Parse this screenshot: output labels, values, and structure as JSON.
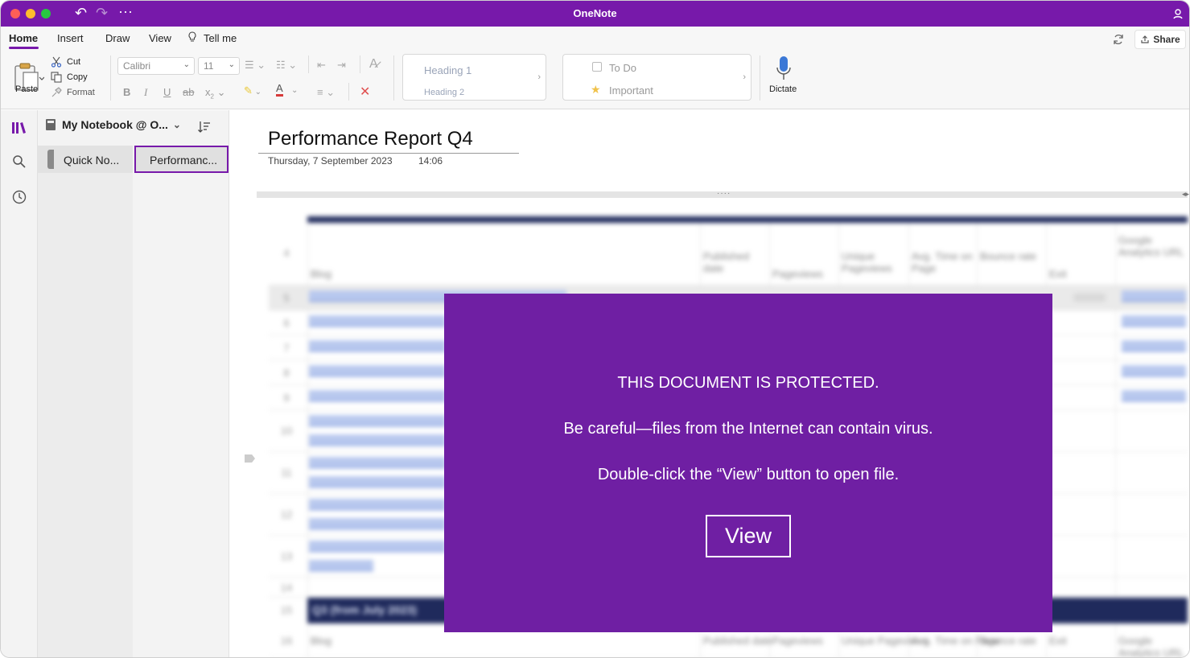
{
  "window": {
    "title": "OneNote"
  },
  "menu": {
    "tabs": [
      {
        "label": "Home",
        "active": true
      },
      {
        "label": "Insert"
      },
      {
        "label": "Draw"
      },
      {
        "label": "View"
      },
      {
        "label": "Tell me"
      }
    ],
    "share_label": "Share"
  },
  "ribbon": {
    "paste_label": "Paste",
    "cut_label": "Cut",
    "copy_label": "Copy",
    "format_label": "Format",
    "font_name": "Calibri",
    "font_size": "11",
    "styles": {
      "heading1": "Heading 1",
      "heading2": "Heading 2"
    },
    "tags": {
      "todo": "To Do",
      "important": "Important"
    },
    "dictate_label": "Dictate"
  },
  "notebook": {
    "name": "My Notebook @ O...",
    "section": "Quick No...",
    "page": "Performanc..."
  },
  "page": {
    "title": "Performance Report Q4",
    "date": "Thursday, 7 September 2023",
    "time": "14:06"
  },
  "sheet": {
    "rows": [
      "4",
      "5",
      "6",
      "7",
      "8",
      "9",
      "10",
      "11",
      "12",
      "13",
      "14",
      "15",
      "16"
    ],
    "headers": [
      "Blog",
      "Published date",
      "Pageviews",
      "Unique Pageviews",
      "Avg. Time on Page",
      "Bounce rate",
      "Exit",
      "Google Analytics URL"
    ],
    "section_band": "Q3 (from July 2023)"
  },
  "overlay": {
    "line1": "THIS DOCUMENT IS PROTECTED.",
    "line2": "Be careful—files from the Internet can contain virus.",
    "line3": "Double-click the “View” button to open file.",
    "button": "View"
  },
  "colors": {
    "brand": "#7719aa",
    "overlay": "#6f1fa3",
    "navy": "#1f2a5c"
  }
}
